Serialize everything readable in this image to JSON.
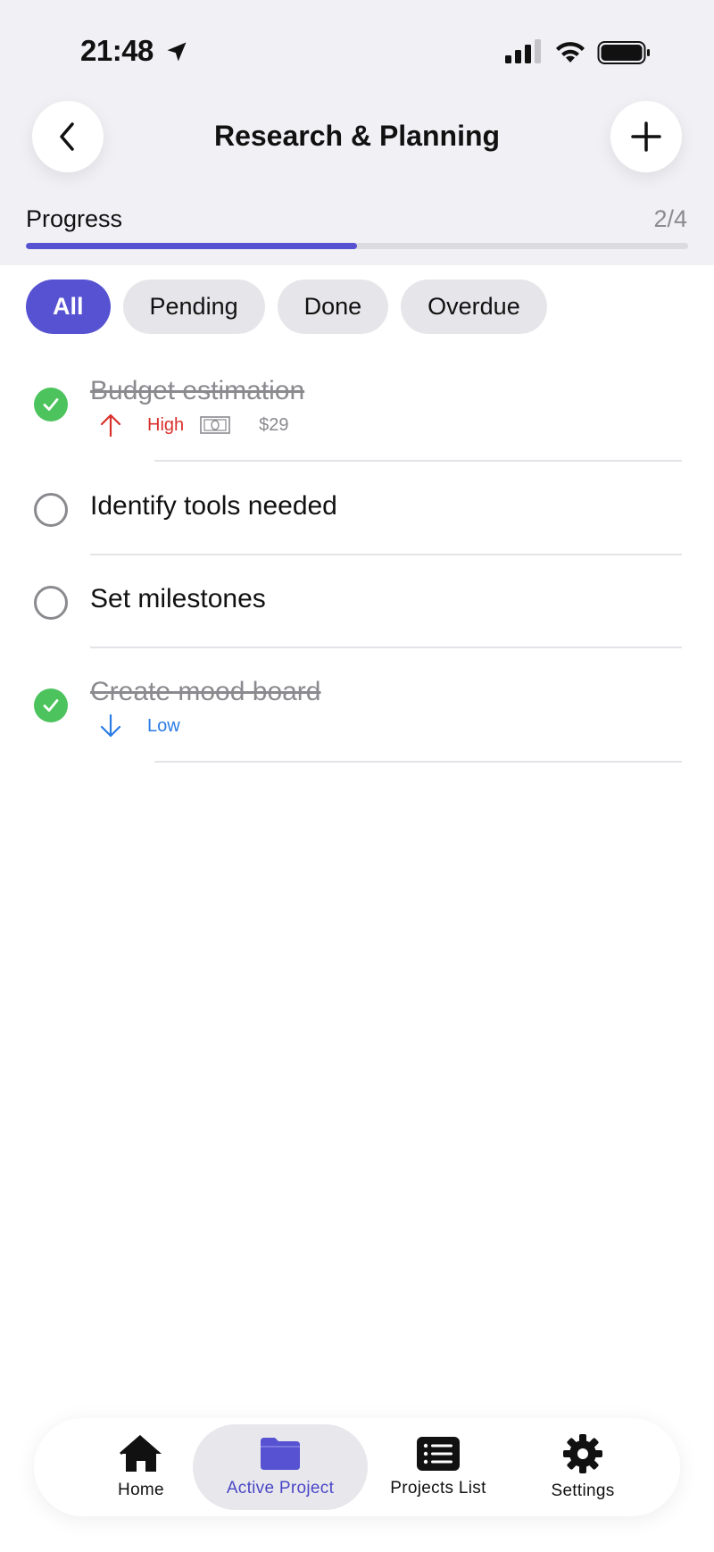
{
  "status_bar": {
    "time": "21:48"
  },
  "header": {
    "title": "Research & Planning"
  },
  "progress": {
    "label": "Progress",
    "count": "2/4",
    "fraction": 0.5
  },
  "filters": [
    {
      "label": "All",
      "active": true
    },
    {
      "label": "Pending",
      "active": false
    },
    {
      "label": "Done",
      "active": false
    },
    {
      "label": "Overdue",
      "active": false
    }
  ],
  "tasks": [
    {
      "title": "Budget estimation",
      "done": true,
      "priority": "High",
      "price": "$29"
    },
    {
      "title": "Identify tools needed",
      "done": false
    },
    {
      "title": "Set milestones",
      "done": false
    },
    {
      "title": "Create mood board",
      "done": true,
      "priority": "Low"
    }
  ],
  "tabbar": {
    "items": [
      {
        "label": "Home",
        "icon": "house-icon"
      },
      {
        "label": "Active Project",
        "icon": "folder-icon",
        "active": true
      },
      {
        "label": "Projects List",
        "icon": "list-icon"
      },
      {
        "label": "Settings",
        "icon": "gear-icon"
      }
    ]
  },
  "colors": {
    "accent": "#5652d2",
    "done": "#4cc35d",
    "high": "#d9302b",
    "low": "#2a7be4",
    "header_bg": "#f1f0f5"
  }
}
